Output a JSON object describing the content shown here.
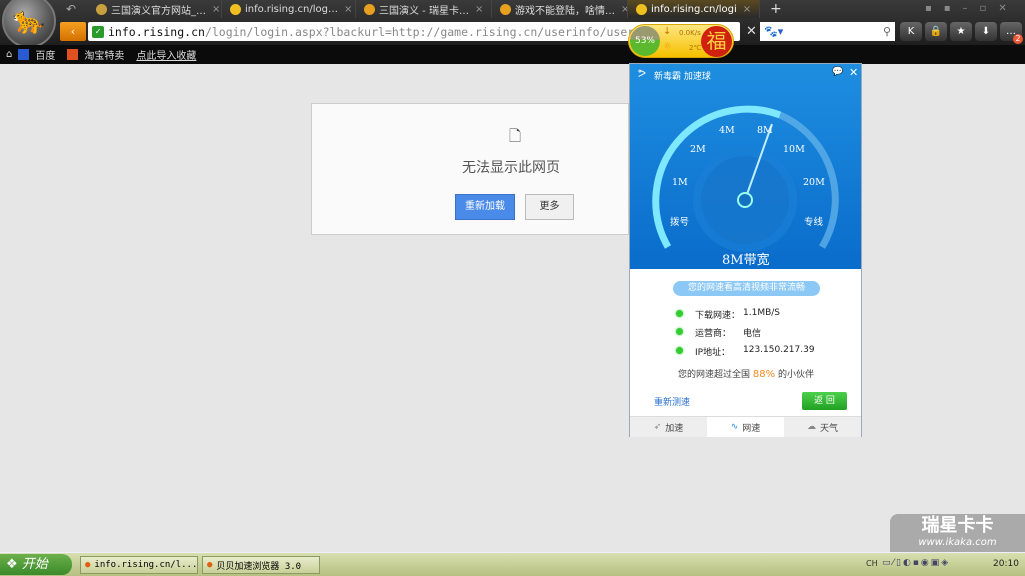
{
  "browser": {
    "tabs": [
      {
        "label": "三国演义官方网站_…",
        "icon": "game-icon",
        "color": "#c9a040"
      },
      {
        "label": "info.rising.cn/log…",
        "icon": "loading-icon",
        "color": "#f0c020"
      },
      {
        "label": "三国演义 - 瑞星卡…",
        "icon": "shield-icon",
        "color": "#e8a020"
      },
      {
        "label": "游戏不能登陆，啥情…",
        "icon": "shield-icon",
        "color": "#e8a020"
      },
      {
        "label": "info.rising.cn/logi",
        "icon": "loading-icon",
        "color": "#f0c020"
      }
    ],
    "close_glyph": "×",
    "new_tab": "+",
    "url_host": "info.rising.cn",
    "url_path": "/login/login.aspx?lbackurl=http://game.rising.cn/userinfo/user/controlurl",
    "toolbar_buttons": [
      "K",
      "🔒",
      "★",
      "⬇",
      "…"
    ],
    "badge": "2",
    "bookmarks": [
      "百度",
      "淘宝特卖",
      "点此导入收藏"
    ]
  },
  "weather": {
    "percent": "53%",
    "speed": "0.0K/s",
    "temp": "2℃",
    "fu": "福"
  },
  "error": {
    "title": "无法显示此网页",
    "reload": "重新加载",
    "more": "更多"
  },
  "speed_widget": {
    "title": "新毒霸 加速球",
    "gauge_labels": [
      "拨号",
      "1M",
      "2M",
      "4M",
      "8M",
      "10M",
      "20M",
      "专线"
    ],
    "needle_value": "8M",
    "bandwidth": "8M带宽",
    "banner": "您的网速看高清视频非常流畅",
    "rows": [
      {
        "label": "下载网速：",
        "value": "1.1MB/S"
      },
      {
        "label": "运营商：",
        "value": "电信"
      },
      {
        "label": "IP地址：",
        "value": "123.150.217.39"
      }
    ],
    "rank_prefix": "您的网速超过全国",
    "rank_pct": "88%",
    "rank_suffix": "的小伙伴",
    "retest": "重新测速",
    "back": "返 回",
    "tabs": [
      "加速",
      "网速",
      "天气"
    ]
  },
  "taskbar": {
    "start": "开始",
    "items": [
      "info.rising.cn/l...",
      "贝贝加速浏览器 3.0"
    ],
    "lang": "CH",
    "clock": "20:10"
  },
  "watermark": {
    "brand": "瑞星卡卡",
    "url": "www.ikaka.com"
  }
}
